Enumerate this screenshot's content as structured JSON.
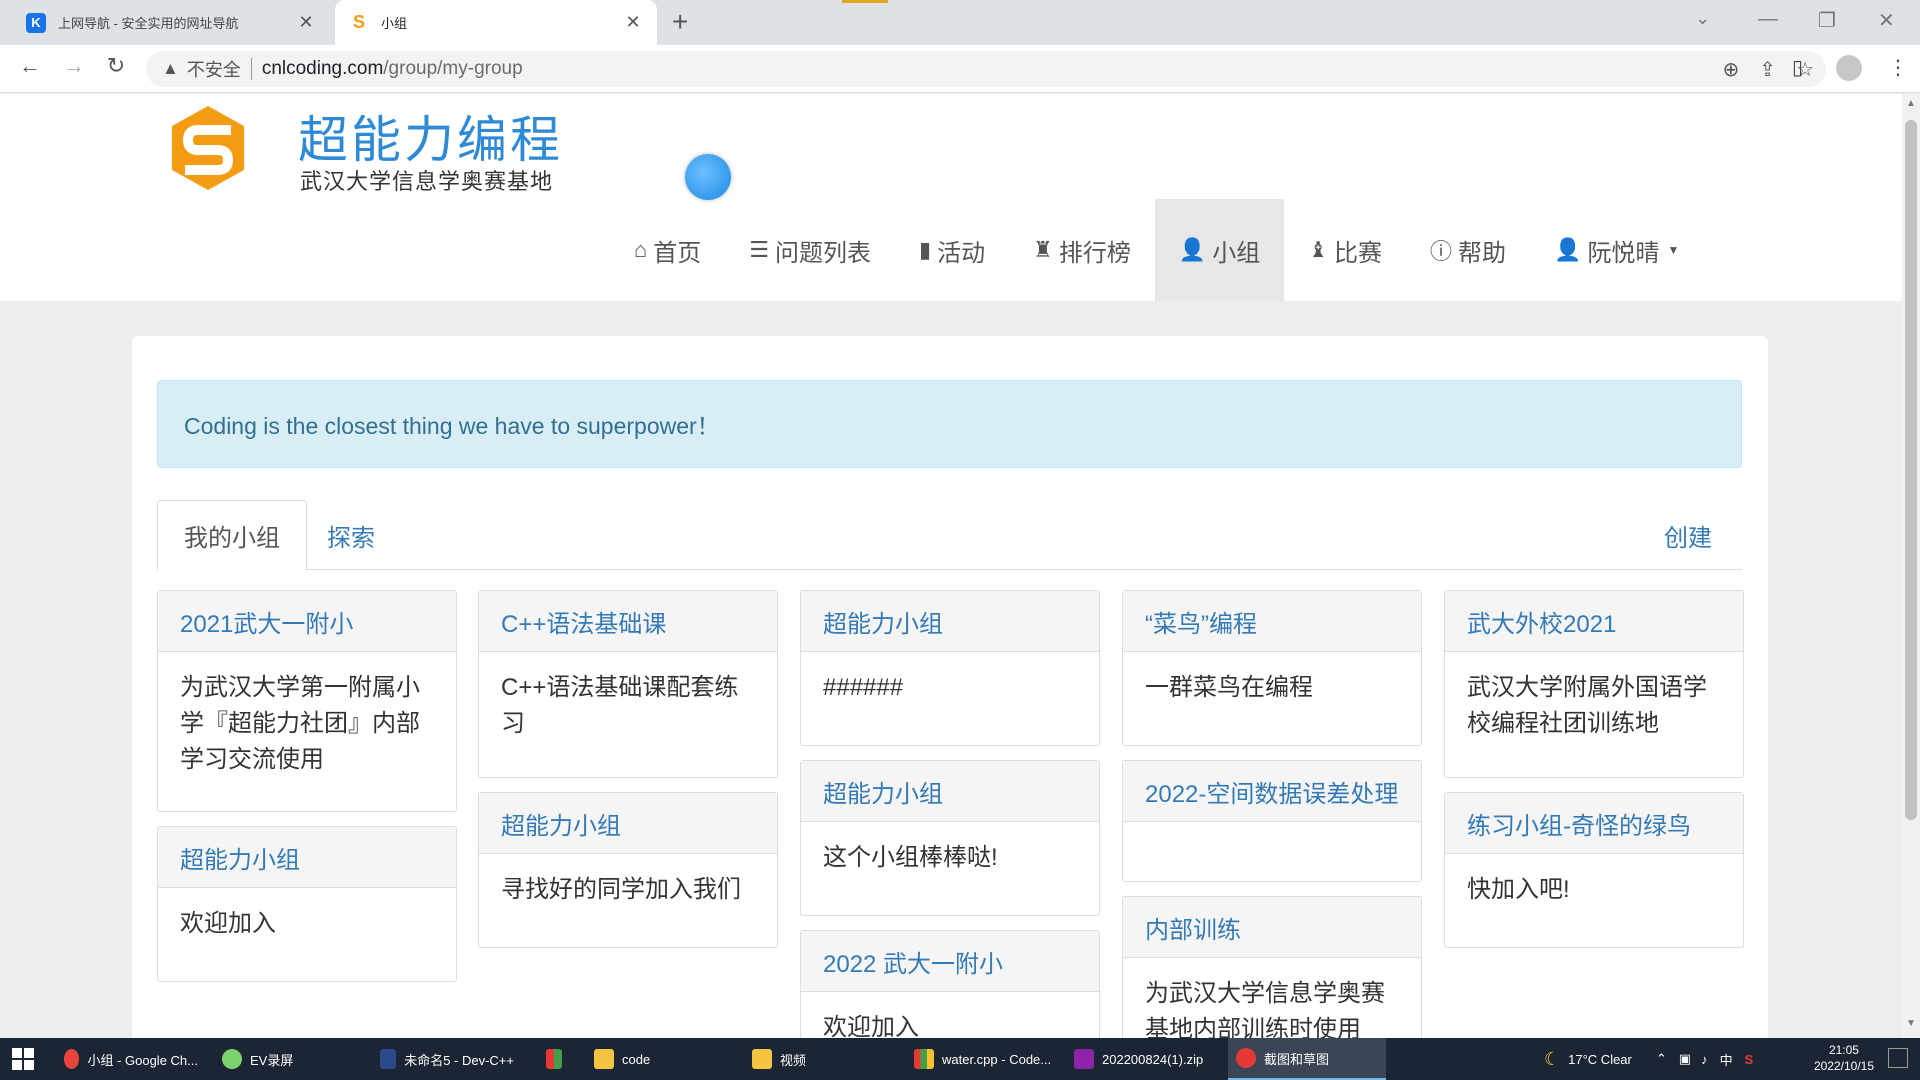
{
  "browser": {
    "tabs": [
      {
        "title": "上网导航 - 安全实用的网址导航",
        "close": "✕"
      },
      {
        "title": "小组",
        "close": "✕"
      }
    ],
    "new_tab": "+",
    "security_label": "不安全",
    "url_host": "cnlcoding.com",
    "url_path": "/group/my-group"
  },
  "site": {
    "brand_title": "超能力编程",
    "brand_subtitle": "武汉大学信息学奥赛基地",
    "nav": [
      {
        "icon": "⌂",
        "label": "首页"
      },
      {
        "icon": "☰",
        "label": "问题列表"
      },
      {
        "icon": "▮",
        "label": "活动"
      },
      {
        "icon": "♜",
        "label": "排行榜"
      },
      {
        "icon": "👤",
        "label": "小组"
      },
      {
        "icon": "♝",
        "label": "比赛"
      },
      {
        "icon": "ⓘ",
        "label": "帮助"
      },
      {
        "icon": "👤",
        "label": "阮悦晴"
      }
    ],
    "active_nav": "小组"
  },
  "alert": {
    "text": "Coding is the closest thing we have to superpower！"
  },
  "group_tabs": {
    "my_groups": "我的小组",
    "explore": "探索",
    "create": "创建"
  },
  "groups": [
    {
      "name": "2021武大一附小",
      "desc": "为武汉大学第一附属小学『超能力社团』内部学习交流使用"
    },
    {
      "name": "超能力小组",
      "desc": "欢迎加入"
    },
    {
      "name": "C++语法基础课",
      "desc": "C++语法基础课配套练习"
    },
    {
      "name": "超能力小组",
      "desc": "寻找好的同学加入我们"
    },
    {
      "name": "超能力小组",
      "desc": "######"
    },
    {
      "name": "超能力小组",
      "desc": "这个小组棒棒哒!"
    },
    {
      "name": "2022 武大一附小",
      "desc": "欢迎加入"
    },
    {
      "name": "“菜鸟”编程",
      "desc": "一群菜鸟在编程"
    },
    {
      "name": "2022-空间数据误差处理",
      "desc": ""
    },
    {
      "name": "内部训练",
      "desc": "为武汉大学信息学奥赛基地内部训练时使用"
    },
    {
      "name": "武大外校2021",
      "desc": "武汉大学附属外国语学校编程社团训练地"
    },
    {
      "name": "练习小组-奇怪的绿鸟",
      "desc": "快加入吧!"
    }
  ],
  "taskbar": {
    "items": [
      "小组 - Google Ch...",
      "EV录屏",
      "未命名5 - Dev-C++",
      "code",
      "视频",
      "water.cpp - Code...",
      "202200824(1).zip",
      "截图和草图"
    ],
    "weather": "17°C  Clear",
    "ime": "中",
    "time": "21:05",
    "date": "2022/10/15"
  },
  "colors": {
    "brand_blue": "#2f8ad6",
    "brand_orange": "#f39c12",
    "link_blue": "#337ab7",
    "alert_bg": "#d9edf7",
    "alert_text": "#31708f"
  }
}
